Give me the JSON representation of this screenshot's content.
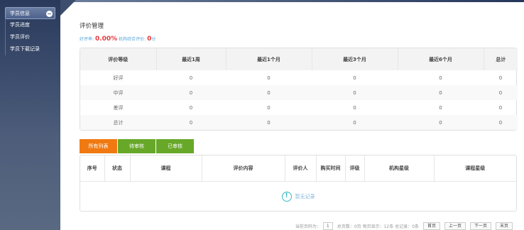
{
  "sidebar": {
    "items": [
      {
        "label": "学员信息"
      },
      {
        "label": "学员进度"
      },
      {
        "label": "学员评价"
      },
      {
        "label": "学员下载记录"
      }
    ]
  },
  "main": {
    "title": "评价管理",
    "summary": {
      "good_rate_label": "好评率:",
      "good_rate_value": "0.00%",
      "org_score_label": "机构综合评价:",
      "org_score_value": "0",
      "org_score_unit": "分"
    }
  },
  "stats_table": {
    "headers": [
      "评价等级",
      "最近1周",
      "最近1个月",
      "最近3个月",
      "最近6个月",
      "总计"
    ],
    "rows": [
      [
        "好评",
        "0",
        "0",
        "0",
        "0",
        "0"
      ],
      [
        "中评",
        "0",
        "0",
        "0",
        "0",
        "0"
      ],
      [
        "差评",
        "0",
        "0",
        "0",
        "0",
        "0"
      ],
      [
        "总计",
        "0",
        "0",
        "0",
        "0",
        "0"
      ]
    ]
  },
  "tabs": [
    "所有列表",
    "待审核",
    "已审核"
  ],
  "list_table": {
    "headers": [
      "序号",
      "状态",
      "课程",
      "评价内容",
      "评价人",
      "购买时间",
      "评级",
      "机构星级",
      "课程星级"
    ],
    "empty_text": "暂无记录"
  },
  "pager": {
    "current_label": "当前页码为：",
    "current_page": "1",
    "info": "总页数：0页 每页显示：12条 总记录：0条",
    "first": "首页",
    "prev": "上一页",
    "next": "下一页",
    "last": "末页"
  }
}
